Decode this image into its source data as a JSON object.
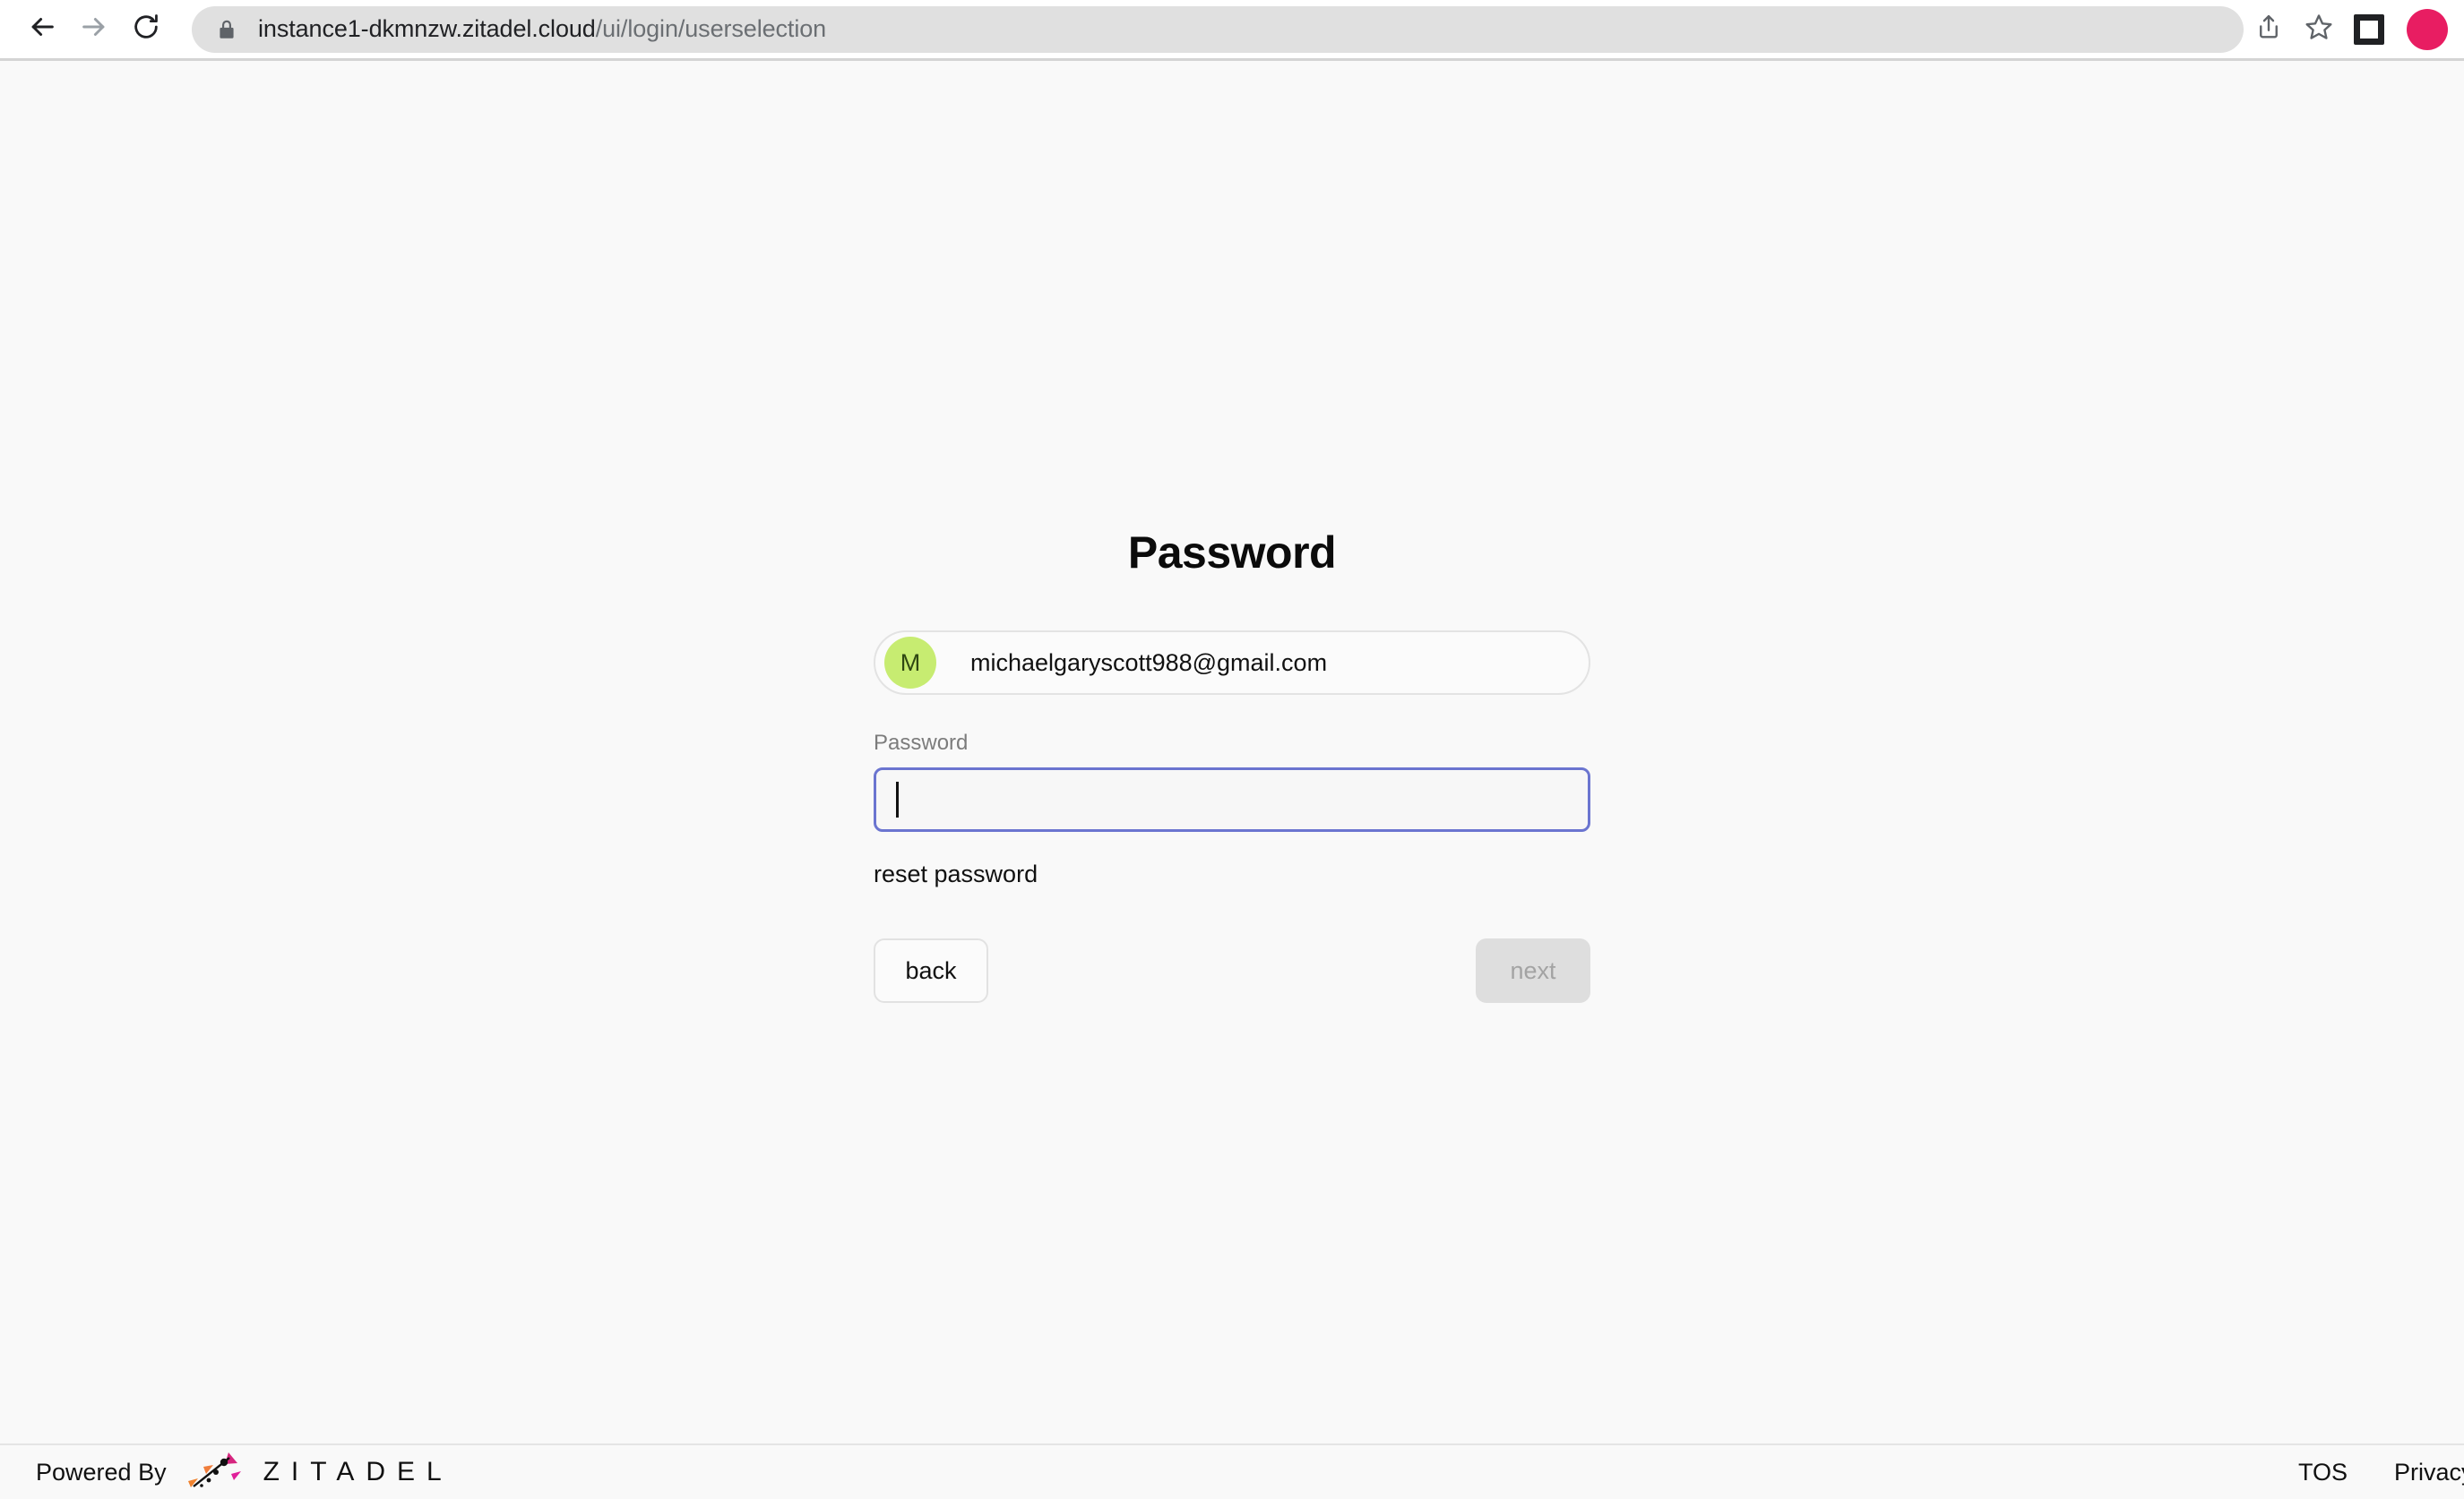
{
  "browser": {
    "nav": {
      "back_icon": "arrow-left-icon",
      "forward_icon": "arrow-right-icon",
      "reload_icon": "reload-icon"
    },
    "url": {
      "lock_icon": "lock-icon",
      "host": "instance1-dkmnzw.zitadel.cloud",
      "path": "/ui/login/userselection",
      "full": "instance1-dkmnzw.zitadel.cloud/ui/login/userselection"
    },
    "actions": {
      "share_icon": "share-icon",
      "bookmark_icon": "star-icon",
      "sidebar_icon": "sidebar-panel-icon",
      "profile_icon": "profile-avatar-icon"
    }
  },
  "page": {
    "title": "Password",
    "user": {
      "avatar_initial": "M",
      "avatar_color": "#c7ec71",
      "email": "michaelgaryscott988@gmail.com"
    },
    "password_field": {
      "label": "Password",
      "value": "",
      "placeholder": "",
      "focus_color": "#6b75d0"
    },
    "reset_link": "reset password",
    "buttons": {
      "back": "back",
      "next": "next"
    }
  },
  "footer": {
    "powered_by": "Powered By",
    "brand": "ZITADEL",
    "links": [
      {
        "label": "TOS"
      },
      {
        "label": "Privacy Policy"
      }
    ]
  }
}
